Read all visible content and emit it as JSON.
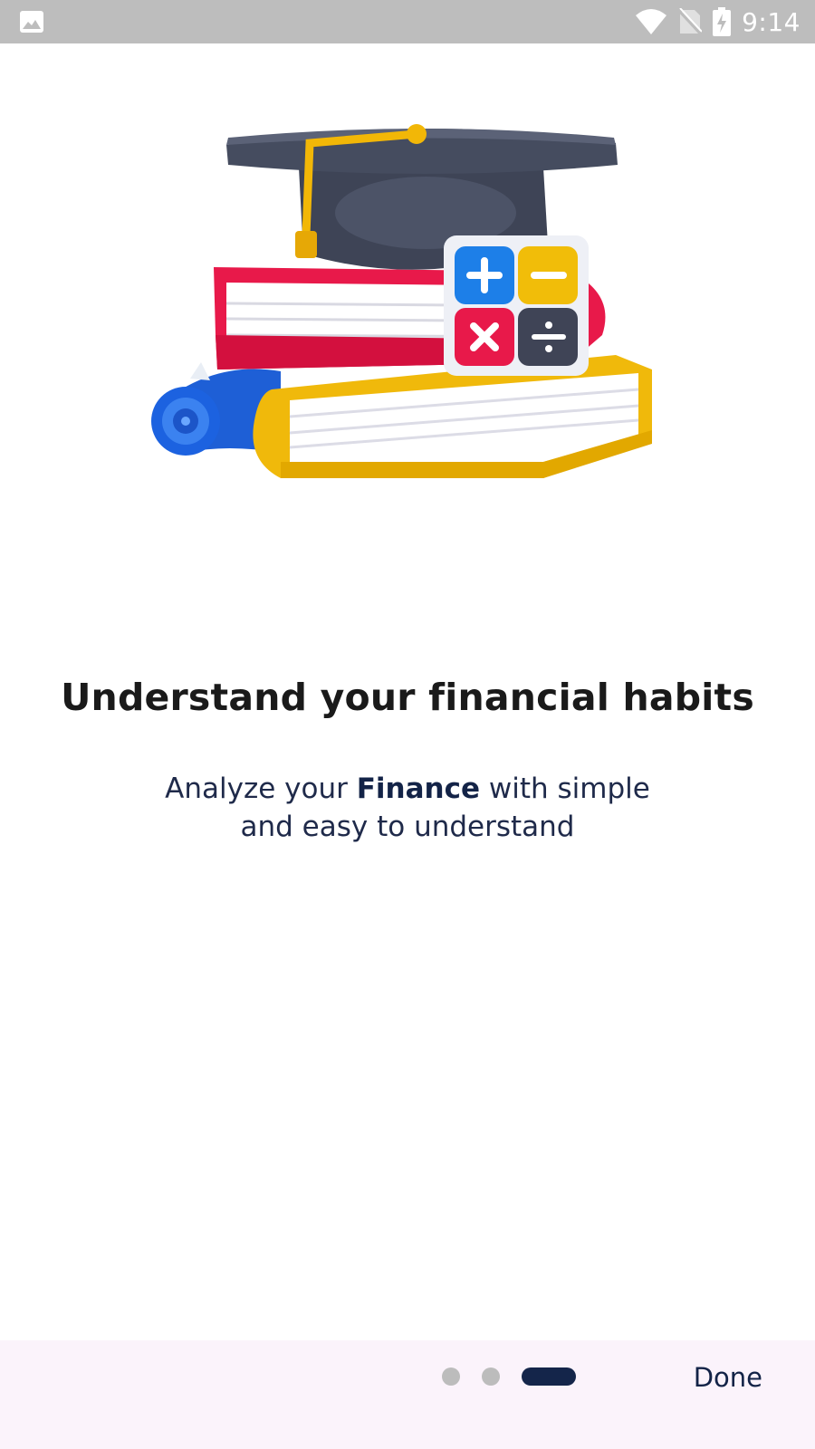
{
  "status_bar": {
    "time": "9:14",
    "left_icon": "image-notification-icon",
    "right_icons": [
      "wifi-icon",
      "no-sim-icon",
      "battery-charging-icon"
    ]
  },
  "onboarding": {
    "illustration": "graduation-cap-books-calculator-illustration",
    "title": "Understand your financial  habits",
    "subtitle_pre": "Analyze your ",
    "subtitle_bold": "Finance",
    "subtitle_post": " with simple",
    "subtitle_line2": "and easy to understand"
  },
  "footer": {
    "done_label": "Done",
    "page_count": 3,
    "current_page": 3
  },
  "colors": {
    "status_bar": "#bdbdbd",
    "title": "#1a1a1a",
    "subtitle": "#1f2a4a",
    "accent": "#14254a",
    "footer_bg": "#fbf3fb",
    "dot_inactive": "#bcbcbc"
  }
}
